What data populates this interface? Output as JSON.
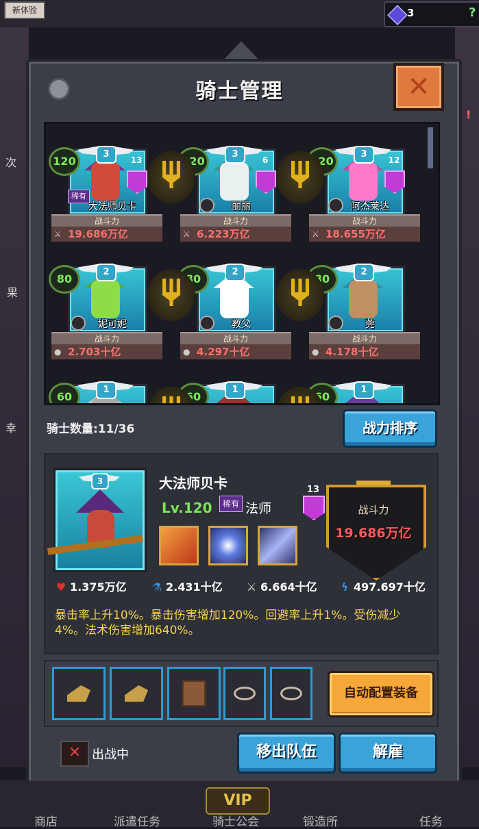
{
  "topbar": {
    "badge": "新体验",
    "gems": "3",
    "help": "?"
  },
  "side": {
    "left_texts": [
      "次",
      "果",
      "幸"
    ],
    "right_texts": [
      "!"
    ]
  },
  "panel": {
    "title": "骑士管理",
    "close": "✕"
  },
  "roster": {
    "cards": [
      {
        "level": "120",
        "stars": "3",
        "crest": "13",
        "name": "大法师贝卡",
        "rare": "稀有",
        "power_label": "战斗力",
        "power": "19.686万亿",
        "hero_color": "#7a2f9a",
        "hair_color": "#d14b3a"
      },
      {
        "level": "120",
        "stars": "3",
        "crest": "6",
        "name": "丽丽",
        "rare": "",
        "power_label": "战斗力",
        "power": "6.223万亿",
        "hero_color": "#2f9a8a",
        "hair_color": "#e8f0f0"
      },
      {
        "level": "120",
        "stars": "3",
        "crest": "12",
        "name": "阿杰莱达",
        "rare": "",
        "power_label": "战斗力",
        "power": "18.655万亿",
        "hero_color": "#d63ba0",
        "hair_color": "#ff7ac8"
      },
      {
        "level": "80",
        "stars": "2",
        "crest": "",
        "name": "妮可妮",
        "rare": "",
        "power_label": "战斗力",
        "power": "2.703十亿",
        "hero_color": "#4fae3a",
        "hair_color": "#8fdc4a"
      },
      {
        "level": "80",
        "stars": "2",
        "crest": "",
        "name": "教父",
        "rare": "",
        "power_label": "战斗力",
        "power": "4.297十亿",
        "hero_color": "#f0f0f0",
        "hair_color": "#ffffff"
      },
      {
        "level": "80",
        "stars": "2",
        "crest": "",
        "name": "莞",
        "rare": "",
        "power_label": "战斗力",
        "power": "4.178十亿",
        "hero_color": "#2a8fa8",
        "hair_color": "#c09060"
      },
      {
        "level": "60",
        "stars": "1",
        "crest": "",
        "name": "",
        "rare": "",
        "power_label": "",
        "power": "",
        "hero_color": "#cccccc",
        "hair_color": "#aaaaaa"
      },
      {
        "level": "60",
        "stars": "1",
        "crest": "",
        "name": "",
        "rare": "",
        "power_label": "",
        "power": "",
        "hero_color": "#a03030",
        "hair_color": "#a03030"
      },
      {
        "level": "60",
        "stars": "1",
        "crest": "",
        "name": "",
        "rare": "",
        "power_label": "",
        "power": "",
        "hero_color": "#6a3a9a",
        "hair_color": "#6a3a9a"
      }
    ]
  },
  "count": {
    "label": "骑士数量:11/36"
  },
  "sort_button": "战力排序",
  "detail": {
    "name": "大法师贝卡",
    "level": "Lv.120",
    "rare": "稀有",
    "class": "法师",
    "crest": "13",
    "power_label": "战斗力",
    "power": "19.686万亿",
    "stats": [
      {
        "icon": "heart-icon",
        "value": "1.375万亿"
      },
      {
        "icon": "potion-icon",
        "value": "2.431十亿"
      },
      {
        "icon": "sword-icon",
        "value": "6.664十亿"
      },
      {
        "icon": "lightning-icon",
        "value": "497.697十亿"
      }
    ],
    "description": "暴击率上升10%。暴击伤害增加120%。回避率上升1%。受伤减少4%。法术伤害增加640%。"
  },
  "equipment": {
    "auto_button": "自动配置装备"
  },
  "bottom": {
    "status": "出战中",
    "remove": "移出队伍",
    "dismiss": "解雇"
  },
  "nav": {
    "items": [
      "商店",
      "派遣任务",
      "骑士公会",
      "锻造所",
      "任务"
    ],
    "vip": "VIP"
  }
}
